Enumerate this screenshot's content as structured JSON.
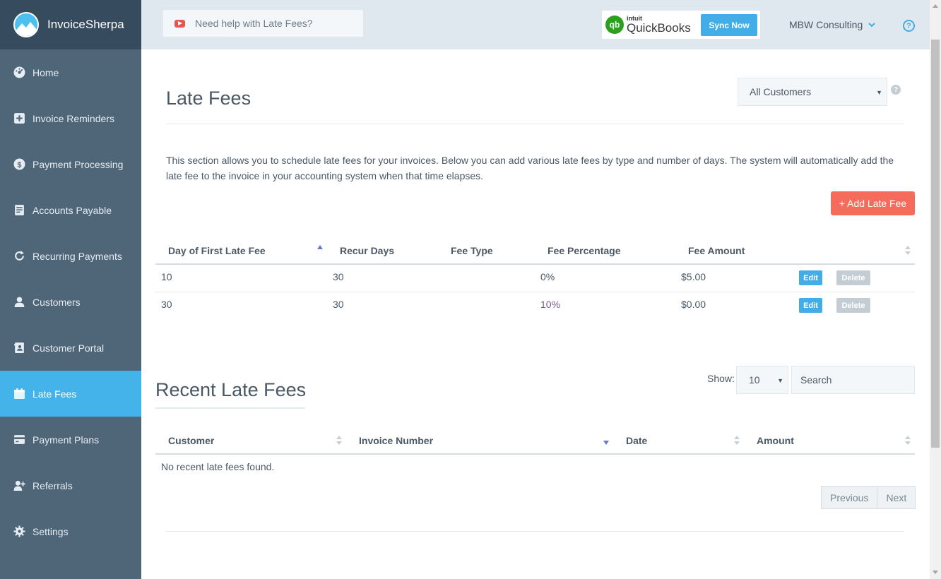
{
  "brand": {
    "name": "InvoiceSherpa"
  },
  "sidebar": {
    "items": [
      {
        "label": "Home",
        "icon": "dashboard-icon",
        "active": false
      },
      {
        "label": "Invoice Reminders",
        "icon": "plus-square-icon",
        "active": false
      },
      {
        "label": "Payment Processing",
        "icon": "dollar-circle-icon",
        "active": false
      },
      {
        "label": "Accounts Payable",
        "icon": "document-icon",
        "active": false
      },
      {
        "label": "Recurring Payments",
        "icon": "refresh-icon",
        "active": false
      },
      {
        "label": "Customers",
        "icon": "user-icon",
        "active": false
      },
      {
        "label": "Customer Portal",
        "icon": "contact-book-icon",
        "active": false
      },
      {
        "label": "Late Fees",
        "icon": "calendar-icon",
        "active": true
      },
      {
        "label": "Payment Plans",
        "icon": "credit-card-icon",
        "active": false
      },
      {
        "label": "Referrals",
        "icon": "user-plus-icon",
        "active": false
      },
      {
        "label": "Settings",
        "icon": "gear-icon",
        "active": false
      }
    ]
  },
  "topbar": {
    "help_text": "Need help with Late Fees?",
    "qb_logo_mark": "qb",
    "qb_intuit": "intuit",
    "qb_name": "QuickBooks",
    "sync_label": "Sync Now",
    "company": "MBW Consulting",
    "help_icon": "?"
  },
  "main": {
    "title": "Late Fees",
    "customer_filter": "All Customers",
    "filter_help": "?",
    "description": "This section allows you to schedule late fees for your invoices. Below you can add various late fees by type and number of days. The system will automatically add the late fee to the invoice in your accounting system when that time elapses.",
    "add_button": "+ Add Late Fee",
    "table": {
      "headers": [
        "Day of First Late Fee",
        "Recur Days",
        "Fee Type",
        "Fee Percentage",
        "Fee Amount"
      ],
      "rows": [
        {
          "first_day": "10",
          "recur": "30",
          "type": "",
          "percentage": "0%",
          "amount": "$5.00"
        },
        {
          "first_day": "30",
          "recur": "30",
          "type": "",
          "percentage": "10%",
          "amount": "$0.00"
        }
      ],
      "edit_label": "Edit",
      "delete_label": "Delete"
    }
  },
  "recent": {
    "title": "Recent Late Fees",
    "show_label": "Show:",
    "show_value": "10",
    "search_placeholder": "Search",
    "headers": [
      "Customer",
      "Invoice Number",
      "Date",
      "Amount"
    ],
    "empty_text": "No recent late fees found.",
    "prev_label": "Previous",
    "next_label": "Next"
  },
  "colors": {
    "sidebar": "#4f6578",
    "brand_bar": "#364b5d",
    "active": "#44b3ea",
    "accent": "#43ade7",
    "add_button": "#f56b5c",
    "topbar": "#dfe8ee"
  }
}
